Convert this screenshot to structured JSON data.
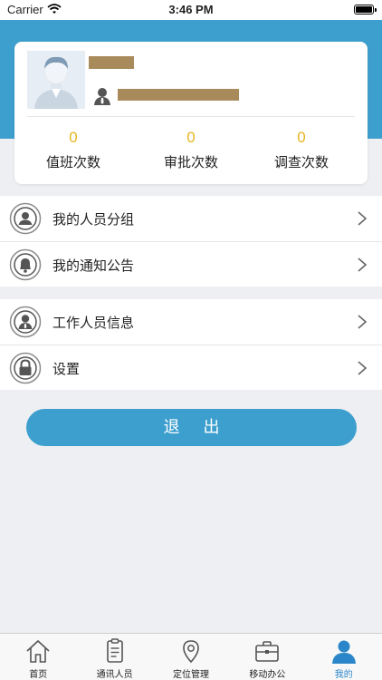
{
  "status_bar": {
    "carrier": "Carrier",
    "time": "3:46 PM"
  },
  "profile": {
    "stats": [
      {
        "value": "0",
        "label": "值班次数"
      },
      {
        "value": "0",
        "label": "审批次数"
      },
      {
        "value": "0",
        "label": "调查次数"
      }
    ]
  },
  "menu": {
    "group1": [
      {
        "label": "我的人员分组",
        "icon": "user-group-icon"
      },
      {
        "label": "我的通知公告",
        "icon": "bell-icon"
      }
    ],
    "group2": [
      {
        "label": "工作人员信息",
        "icon": "staff-info-icon"
      },
      {
        "label": "设置",
        "icon": "lock-icon"
      }
    ]
  },
  "logout_label": "退出",
  "tabs": [
    {
      "label": "首页",
      "icon": "home-icon"
    },
    {
      "label": "通讯人员",
      "icon": "clipboard-icon"
    },
    {
      "label": "定位管理",
      "icon": "location-pin-icon"
    },
    {
      "label": "移动办公",
      "icon": "briefcase-icon"
    },
    {
      "label": "我的",
      "icon": "profile-icon",
      "active": true
    }
  ],
  "colors": {
    "primary": "#3d9fce",
    "stat_value": "#e6b520",
    "active_tab": "#2a86c8",
    "redaction": "#a98a5a"
  }
}
